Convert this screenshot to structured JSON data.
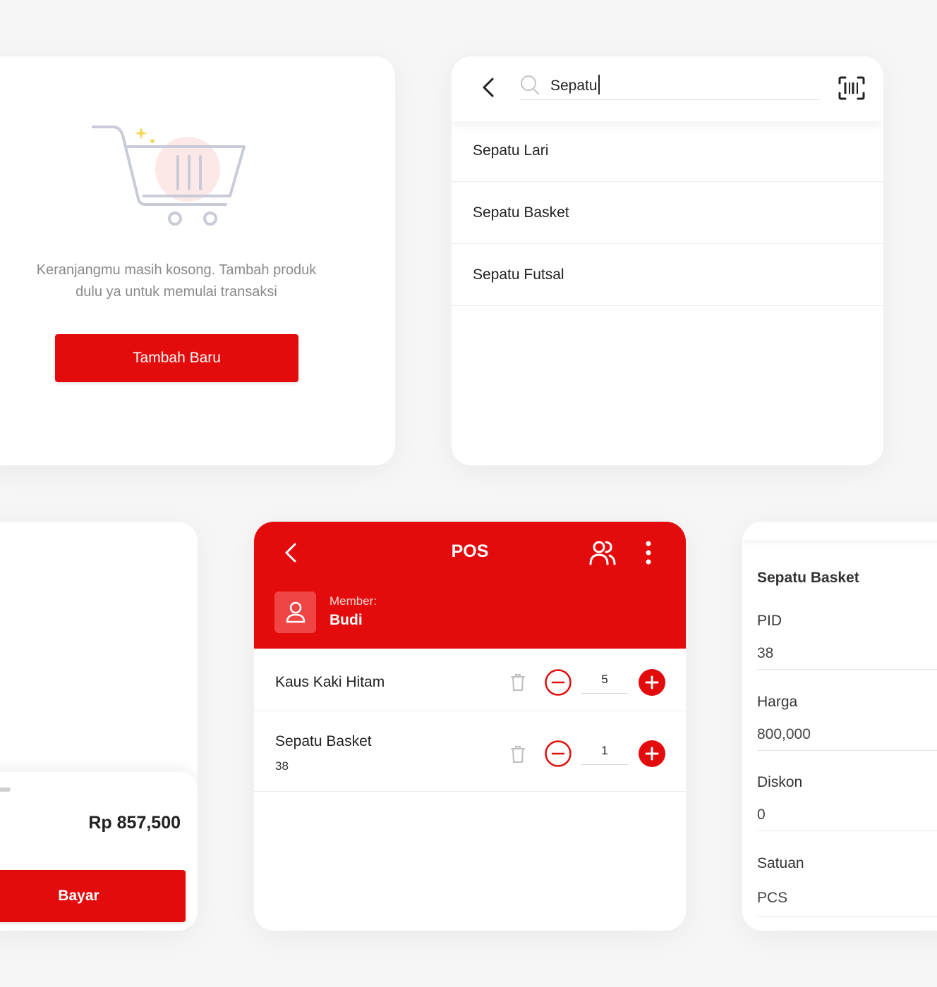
{
  "empty_cart": {
    "message_line1": "Keranjangmu masih kosong. Tambah produk",
    "message_line2": "dulu ya untuk memulai transaksi",
    "add_button": "Tambah Baru"
  },
  "search": {
    "query": "Sepatu",
    "results": [
      "Sepatu Lari",
      "Sepatu Basket",
      "Sepatu Futsal"
    ]
  },
  "payment": {
    "total": "Rp 857,500",
    "pay_button": "Bayar"
  },
  "pos": {
    "title": "POS",
    "member_label": "Member:",
    "member_name": "Budi",
    "items": [
      {
        "name": "Kaus Kaki Hitam",
        "variant": "",
        "qty": "5"
      },
      {
        "name": "Sepatu Basket",
        "variant": "38",
        "qty": "1"
      }
    ]
  },
  "detail": {
    "product_name": "Sepatu Basket",
    "fields": [
      {
        "label": "PID",
        "value": "38"
      },
      {
        "label": "Harga",
        "value": "800,000"
      },
      {
        "label": "Diskon",
        "value": "0"
      },
      {
        "label": "Satuan",
        "value": "PCS"
      }
    ]
  },
  "colors": {
    "primary": "#e30b0b",
    "background": "#f6f6f6",
    "card": "#ffffff"
  },
  "icons": [
    "empty-cart-illustration",
    "back-arrow-icon",
    "search-icon",
    "barcode-scan-icon",
    "users-icon",
    "more-vertical-icon",
    "user-icon",
    "trash-icon",
    "minus-circle-icon",
    "plus-circle-icon"
  ]
}
